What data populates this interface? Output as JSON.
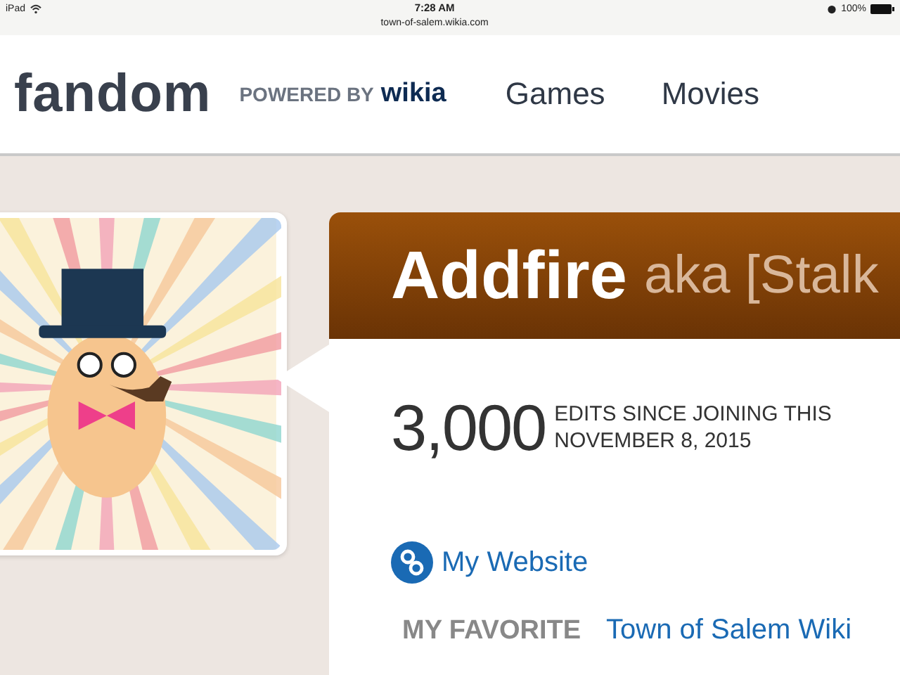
{
  "status_bar": {
    "device": "iPad",
    "time": "7:28 AM",
    "url": "town-of-salem.wikia.com",
    "battery": "100%"
  },
  "header": {
    "logo": "fandom",
    "powered_by": "POWERED BY",
    "brand": "wikia",
    "nav": [
      {
        "label": "Games"
      },
      {
        "label": "Movies"
      }
    ]
  },
  "profile": {
    "name": "Addfire",
    "aka": "aka [Stalk",
    "edits_count": "3,000",
    "edits_label": "EDITS SINCE JOINING THIS",
    "join_date": "NOVEMBER 8, 2015",
    "website": "My Website",
    "favorite_label": "MY FAVORITE",
    "favorite_value": "Town of Salem Wiki"
  }
}
